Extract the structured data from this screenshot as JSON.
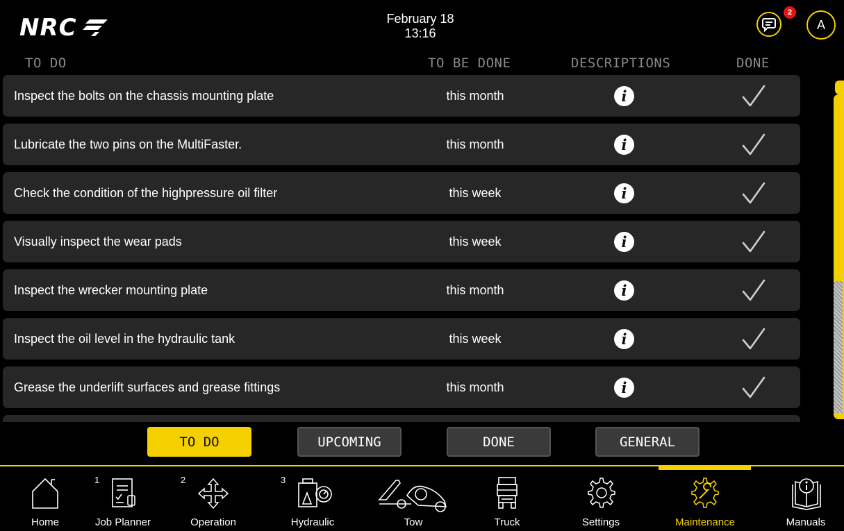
{
  "header": {
    "logo": "NRC",
    "date": "February 18",
    "time": "13:16",
    "notifications_count": "2",
    "user_initial": "A"
  },
  "columns": {
    "todo": "TO DO",
    "to_be_done": "TO BE DONE",
    "descriptions": "DESCRIPTIONS",
    "done": "DONE"
  },
  "tasks": [
    {
      "task": "Inspect the bolts on the chassis mounting plate",
      "due": "this month"
    },
    {
      "task": "Lubricate the two pins on the MultiFaster.",
      "due": "this month"
    },
    {
      "task": "Check the condition of the highpressure oil filter",
      "due": "this week"
    },
    {
      "task": "Visually inspect the wear pads",
      "due": "this week"
    },
    {
      "task": "Inspect the wrecker mounting plate",
      "due": "this month"
    },
    {
      "task": "Inspect the oil level in the hydraulic tank",
      "due": "this week"
    },
    {
      "task": "Grease the underlift surfaces and grease fittings",
      "due": "this month"
    }
  ],
  "tabs": {
    "todo": "TO DO",
    "upcoming": "UPCOMING",
    "done": "DONE",
    "general": "GENERAL",
    "active": "todo"
  },
  "nav": {
    "home": "Home",
    "job_planner": "Job Planner",
    "job_planner_num": "1",
    "operation": "Operation",
    "operation_num": "2",
    "hydraulic": "Hydraulic",
    "hydraulic_num": "3",
    "tow": "Tow",
    "truck": "Truck",
    "settings": "Settings",
    "maintenance": "Maintenance",
    "manuals": "Manuals",
    "active": "maintenance"
  },
  "colors": {
    "accent": "#f5d000",
    "row_bg": "#272727",
    "badge": "#e01515"
  }
}
